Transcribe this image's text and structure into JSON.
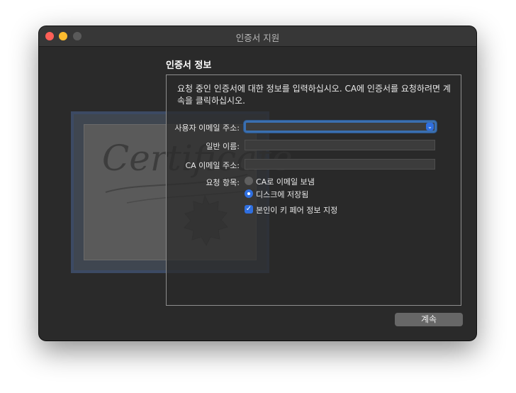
{
  "window": {
    "title": "인증서 지원"
  },
  "cert_art": {
    "script_text": "Certificate"
  },
  "section": {
    "title": "인증서 정보"
  },
  "description": "요청 중인 인증서에 대한 정보를 입력하십시오. CA에 인증서를 요청하려면 계속을 클릭하십시오.",
  "form": {
    "user_email_label": "사용자 이메일 주소:",
    "user_email_value": "",
    "common_name_label": "일반 이름:",
    "common_name_value": "",
    "ca_email_label": "CA 이메일 주소:",
    "ca_email_value": "",
    "request_label": "요청 항목:",
    "option_email_ca": "CA로 이메일 보냄",
    "option_save_disk": "디스크에 저장됨",
    "option_key_pair": "본인이 키 페어 정보 지정",
    "selected_option": "option_save_disk",
    "key_pair_checked": true
  },
  "buttons": {
    "continue": "계속"
  },
  "colors": {
    "accent": "#2f6fe0",
    "focus_ring": "#3a6fb0"
  }
}
